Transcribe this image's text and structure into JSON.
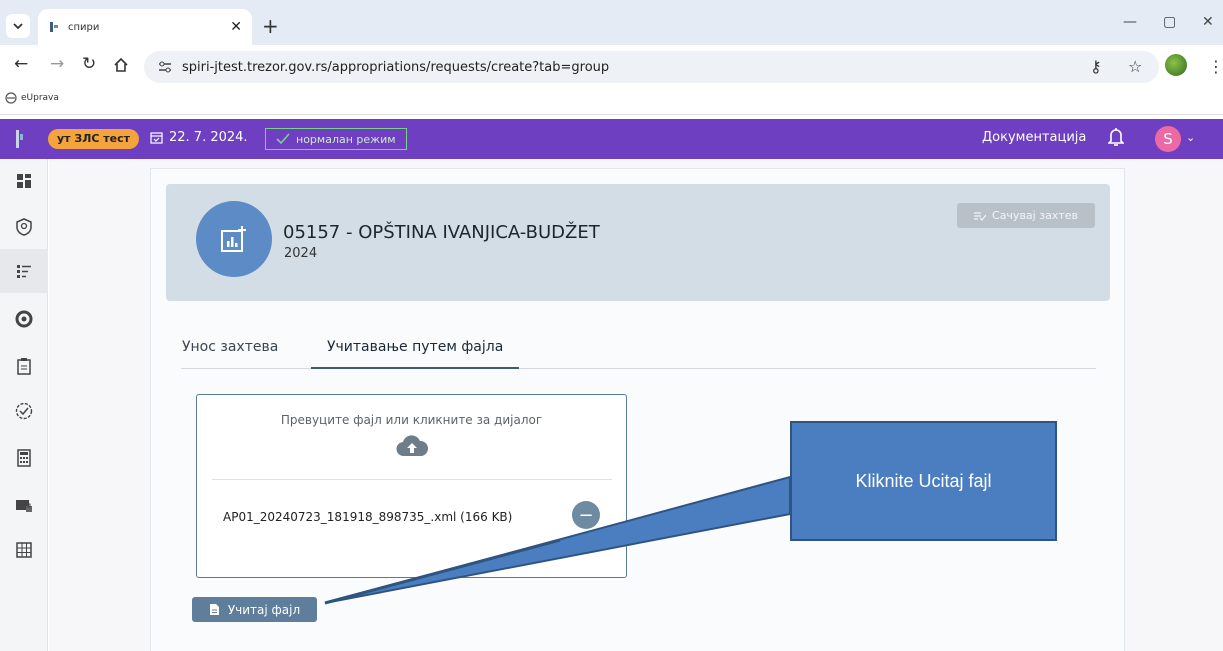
{
  "browser": {
    "tab_title": "спири",
    "url": "spiri-jtest.trezor.gov.rs/appropriations/requests/create?tab=group",
    "bookmark": "eUprava"
  },
  "header": {
    "env_badge": "ут ЗЛС тест",
    "date": "22. 7. 2024.",
    "mode": "нормалан режим",
    "docs_link": "Документација",
    "user_initial": "S"
  },
  "summary": {
    "org_name": "05157 - OPŠTINA IVANJICA-BUDŽET",
    "year": "2024",
    "save_label": "Сачувај захтев"
  },
  "tabs": [
    {
      "label": "Унос захтева",
      "active": false
    },
    {
      "label": "Учитавање путем фајла",
      "active": true
    }
  ],
  "dropzone": {
    "hint": "Превуците фајл или кликните за дијалог",
    "file_name": "AP01_20240723_181918_898735_.xml (166 KB)"
  },
  "upload_button": "Учитај фајл",
  "callout": {
    "text": "Kliknite Ucitaj fajl"
  },
  "colors": {
    "header_bg": "#6e3fc1",
    "badge": "#f5a33b",
    "accent": "#5e7e9c",
    "callout": "#4a7ec0"
  },
  "rail_icons": [
    "dashboard-icon",
    "shield-user-icon",
    "list-filter-icon",
    "chart-ring-icon",
    "clipboard-icon",
    "check-circle-icon",
    "calculator-icon",
    "id-card-icon",
    "table-grid-icon"
  ]
}
